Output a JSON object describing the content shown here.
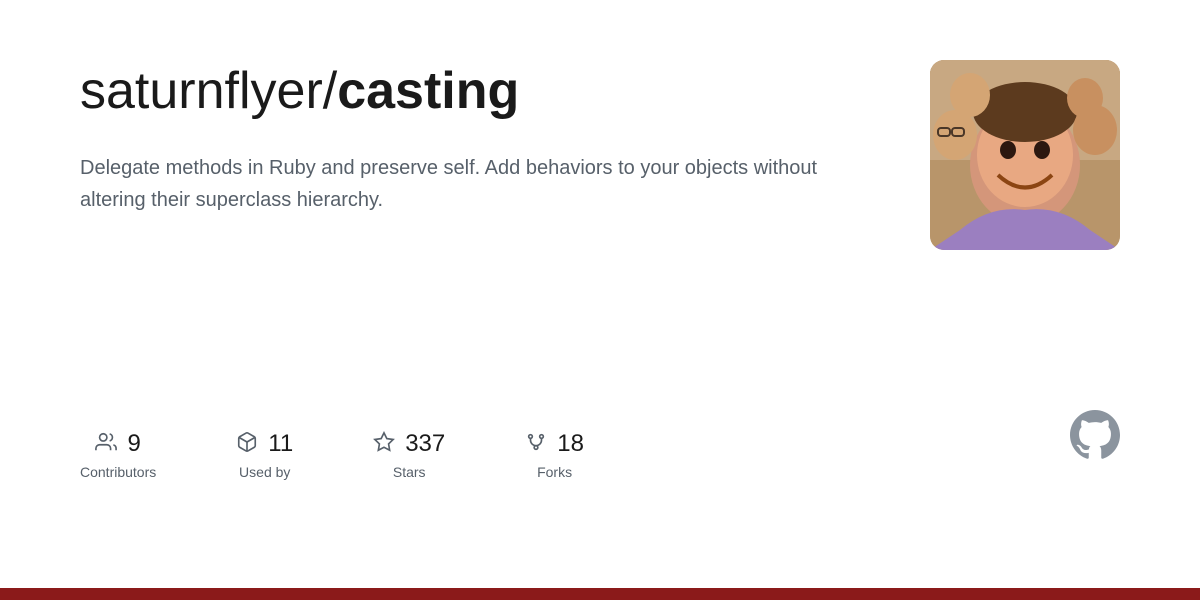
{
  "repo": {
    "owner": "saturnflyer/",
    "name": "casting",
    "description": "Delegate methods in Ruby and preserve self. Add behaviors to your objects without altering their superclass hierarchy.",
    "stats": {
      "contributors": {
        "count": "9",
        "label": "Contributors"
      },
      "used_by": {
        "count": "11",
        "label": "Used by"
      },
      "stars": {
        "count": "337",
        "label": "Stars"
      },
      "forks": {
        "count": "18",
        "label": "Forks"
      }
    }
  },
  "colors": {
    "bottom_bar": "#8b1a1a",
    "text_primary": "#1a1a1a",
    "text_secondary": "#57606a",
    "github_logo": "#8b949e"
  }
}
